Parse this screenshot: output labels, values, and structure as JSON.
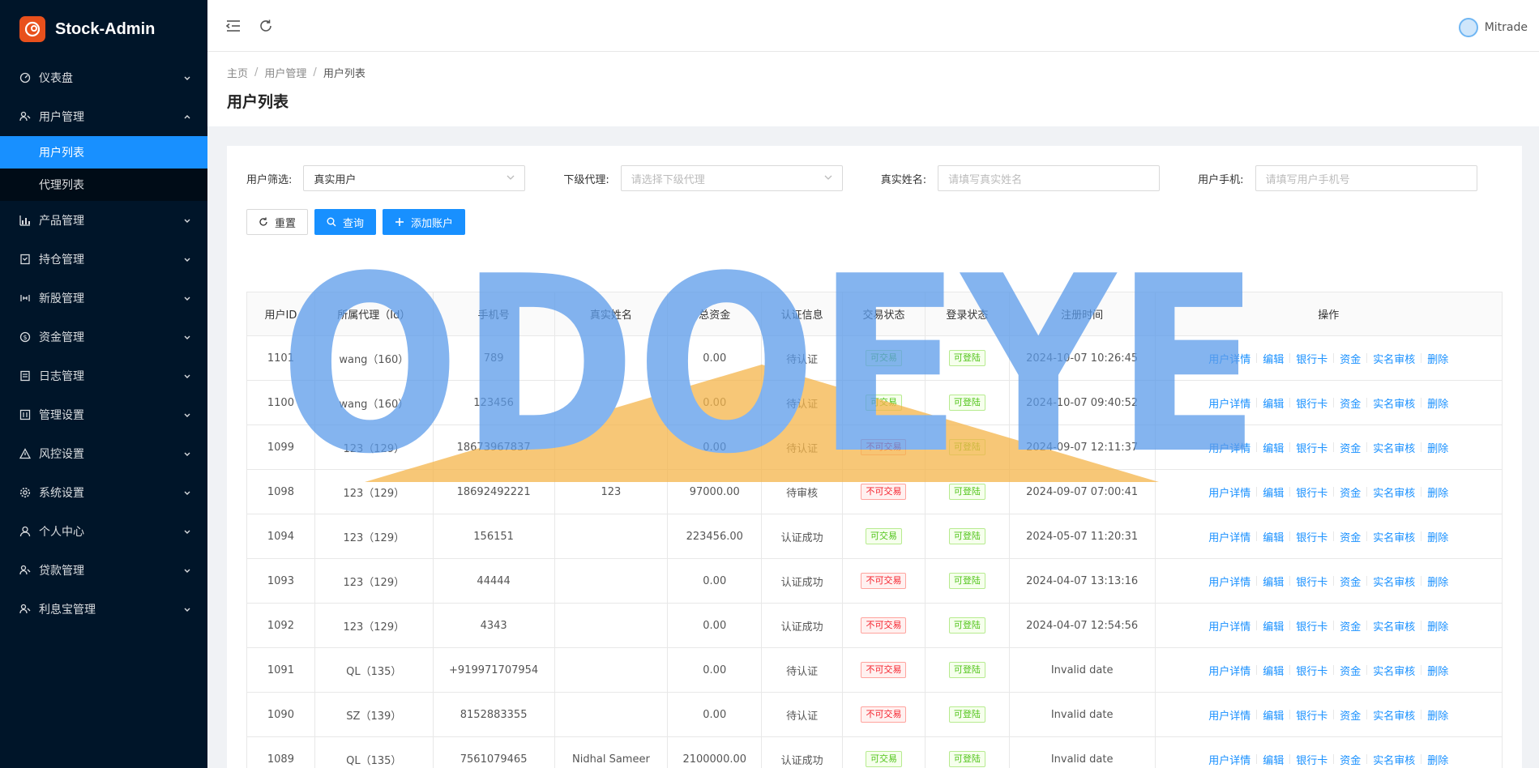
{
  "app": {
    "title": "Stock-Admin"
  },
  "sidebar": {
    "items": [
      {
        "label": "仪表盘",
        "icon": "dashboard-icon"
      },
      {
        "label": "用户管理",
        "icon": "users-icon",
        "open": true,
        "children": [
          {
            "label": "用户列表",
            "active": true
          },
          {
            "label": "代理列表"
          }
        ]
      },
      {
        "label": "产品管理",
        "icon": "chart-icon"
      },
      {
        "label": "持仓管理",
        "icon": "position-icon"
      },
      {
        "label": "新股管理",
        "icon": "ipo-icon"
      },
      {
        "label": "资金管理",
        "icon": "money-icon"
      },
      {
        "label": "日志管理",
        "icon": "log-icon"
      },
      {
        "label": "管理设置",
        "icon": "admin-settings-icon"
      },
      {
        "label": "风控设置",
        "icon": "warning-icon"
      },
      {
        "label": "系统设置",
        "icon": "gear-icon"
      },
      {
        "label": "个人中心",
        "icon": "person-icon"
      },
      {
        "label": "贷款管理",
        "icon": "loan-icon"
      },
      {
        "label": "利息宝管理",
        "icon": "interest-icon"
      }
    ]
  },
  "header": {
    "user_name": "Mitrade"
  },
  "page": {
    "breadcrumb": [
      "主页",
      "用户管理",
      "用户列表"
    ],
    "title": "用户列表"
  },
  "filters": {
    "user_filter": {
      "label": "用户筛选:",
      "value": "真实用户"
    },
    "agent": {
      "label": "下级代理:",
      "placeholder": "请选择下级代理"
    },
    "real_name": {
      "label": "真实姓名:",
      "placeholder": "请填写真实姓名"
    },
    "phone": {
      "label": "用户手机:",
      "placeholder": "请填写用户手机号"
    }
  },
  "actions": {
    "reset": "重置",
    "search": "查询",
    "add": "添加账户"
  },
  "table": {
    "columns": [
      "用户ID",
      "所属代理（Id）",
      "手机号",
      "真实姓名",
      "总资金",
      "认证信息",
      "交易状态",
      "登录状态",
      "注册时间",
      "操作"
    ],
    "ops": [
      "用户详情",
      "编辑",
      "银行卡",
      "资金",
      "实名审核",
      "删除"
    ],
    "rows": [
      {
        "id": "1101",
        "agent": "wang（160）",
        "phone": "789",
        "name": "",
        "funds": "0.00",
        "auth": "待认证",
        "trade": "可交易",
        "trade_ok": true,
        "login": "可登陆",
        "reg": "2024-10-07 10:26:45"
      },
      {
        "id": "1100",
        "agent": "wang（160）",
        "phone": "123456",
        "name": "",
        "funds": "0.00",
        "auth": "待认证",
        "trade": "可交易",
        "trade_ok": true,
        "login": "可登陆",
        "reg": "2024-10-07 09:40:52"
      },
      {
        "id": "1099",
        "agent": "123（129）",
        "phone": "18673967837",
        "name": "",
        "funds": "0.00",
        "auth": "待认证",
        "trade": "不可交易",
        "trade_ok": false,
        "login": "可登陆",
        "reg": "2024-09-07 12:11:37"
      },
      {
        "id": "1098",
        "agent": "123（129）",
        "phone": "18692492221",
        "name": "123",
        "funds": "97000.00",
        "auth": "待审核",
        "trade": "不可交易",
        "trade_ok": false,
        "login": "可登陆",
        "reg": "2024-09-07 07:00:41"
      },
      {
        "id": "1094",
        "agent": "123（129）",
        "phone": "156151",
        "name": "",
        "funds": "223456.00",
        "auth": "认证成功",
        "trade": "可交易",
        "trade_ok": true,
        "login": "可登陆",
        "reg": "2024-05-07 11:20:31"
      },
      {
        "id": "1093",
        "agent": "123（129）",
        "phone": "44444",
        "name": "",
        "funds": "0.00",
        "auth": "认证成功",
        "trade": "不可交易",
        "trade_ok": false,
        "login": "可登陆",
        "reg": "2024-04-07 13:13:16"
      },
      {
        "id": "1092",
        "agent": "123（129）",
        "phone": "4343",
        "name": "",
        "funds": "0.00",
        "auth": "认证成功",
        "trade": "不可交易",
        "trade_ok": false,
        "login": "可登陆",
        "reg": "2024-04-07 12:54:56"
      },
      {
        "id": "1091",
        "agent": "QL（135）",
        "phone": "+919971707954",
        "name": "",
        "funds": "0.00",
        "auth": "待认证",
        "trade": "不可交易",
        "trade_ok": false,
        "login": "可登陆",
        "reg": "Invalid date"
      },
      {
        "id": "1090",
        "agent": "SZ（139）",
        "phone": "8152883355",
        "name": "",
        "funds": "0.00",
        "auth": "待认证",
        "trade": "不可交易",
        "trade_ok": false,
        "login": "可登陆",
        "reg": "Invalid date"
      },
      {
        "id": "1089",
        "agent": "QL（135）",
        "phone": "7561079465",
        "name": "Nidhal Sameer",
        "funds": "2100000.00",
        "auth": "认证成功",
        "trade": "可交易",
        "trade_ok": true,
        "login": "可登陆",
        "reg": "Invalid date"
      }
    ]
  },
  "watermark": {
    "text": "ODOEYE"
  },
  "colors": {
    "sidebar_bg": "#001529",
    "primary": "#1890ff",
    "green": "#52c41a",
    "red": "#f5222d",
    "watermark_blue": "#5b9bea",
    "watermark_orange": "#f5b54a"
  }
}
